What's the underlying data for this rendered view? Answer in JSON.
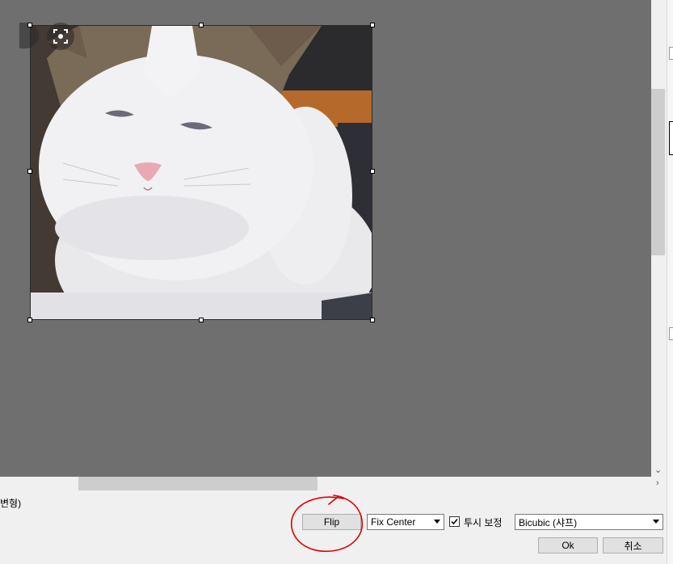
{
  "canvas": {
    "background": "#6f6f6f",
    "image_subject": "white and tabby cat"
  },
  "left_label": "변형)",
  "controls": {
    "flip_label": "Flip",
    "anchor_select_value": "Fix Center",
    "perspective_checked": true,
    "perspective_label": "투시 보정",
    "interpolation_select_value": "Bicubic (샤프)",
    "ok_label": "Ok",
    "cancel_label": "취소"
  },
  "annotation": {
    "shape": "hand-drawn circle",
    "color": "#e00000",
    "target": "Flip button"
  },
  "icons": {
    "lens": "lens-icon",
    "vscroll_down": "chevron-down-icon",
    "hscroll_right": "chevron-right-icon",
    "checkbox": "checkmark-icon",
    "select_caret": "caret-down-icon"
  }
}
